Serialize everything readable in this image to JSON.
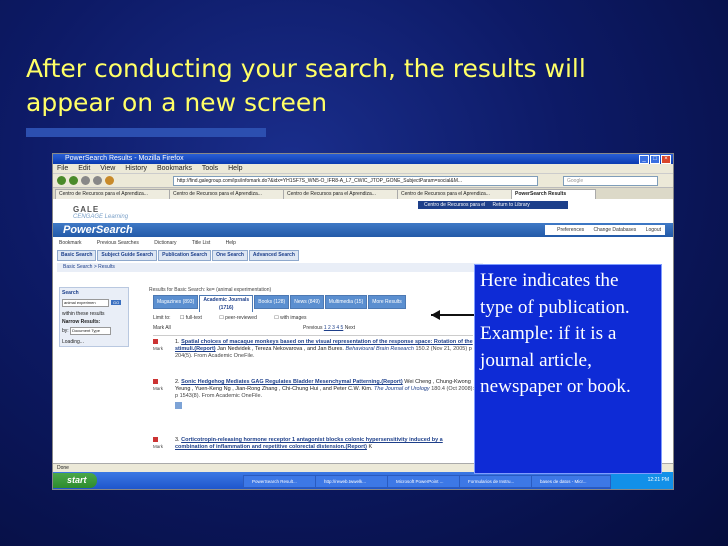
{
  "slide": {
    "title": "After conducting your search, the results will appear on a new screen",
    "callout_text": "Here indicates the type of publication. Example: if it is a journal article, newspaper or book.",
    "colors": {
      "title": "#ffff66",
      "background": "#0d1a66",
      "callout_bg": "#0e2bd6"
    }
  },
  "browser": {
    "window_title": "PowerSearch Results - Mozilla Firefox",
    "menu": [
      "File",
      "Edit",
      "View",
      "History",
      "Bookmarks",
      "Tools",
      "Help"
    ],
    "url": "http://find.galegroup.com/ips/infomark.do?&idx=YH1SF7S_WN5-O_IFR8-A_L7_CWIC_JTOP_GONE_SubjectParam=social&M...",
    "search_placeholder": "Google",
    "tabs": [
      "Centro de Recursos para el Aprendiza...",
      "Centro de Recursos para el Aprendiza...",
      "Centro de Recursos para el Aprendiza...",
      "Centro de Recursos para el Aprendiza...",
      "PowerSearch Results"
    ],
    "status": "Done"
  },
  "page": {
    "gale_name": "GALE",
    "gale_sub": "CENGAGE Learning",
    "top_links": [
      "Centro de Recursos para el",
      "Return to Library"
    ],
    "logo": "PowerSearch",
    "right_links": [
      "Preferences",
      "Change Databases",
      "Logout"
    ],
    "toolbar": [
      "Bookmark",
      "Previous Searches",
      "Dictionary",
      "Title List",
      "Help"
    ],
    "search_tabs": [
      "Basic Search",
      "Subject Guide Search",
      "Publication Search",
      "One Search",
      "Advanced Search"
    ],
    "breadcrumb": "Basic Search > Results",
    "left_panel": {
      "heading": "Search",
      "input_value": "animal experimen",
      "go": "GO",
      "within": "within these results",
      "narrow": "Narrow Results:",
      "by_label": "by:",
      "by_value": "Document Type",
      "loading": "Loading..."
    },
    "results_info": "Results for Basic Search: ke= (animal experimentation)",
    "pub_tabs": [
      "Magazines (893)",
      "Academic Journals (1716)",
      "Books (128)",
      "News (849)",
      "Multimedia (15)",
      "More Results"
    ],
    "limit_label": "Limit to:",
    "limit_options": [
      "full-text",
      "peer-reviewed",
      "with images"
    ],
    "mark_all": "Mark All",
    "pagination": {
      "prev": "Previous",
      "pages": "1 2 3 4 5",
      "next": "Next"
    },
    "mark_label": "Mark",
    "results": [
      {
        "num": "1.",
        "title": "Spatial choices of macaque monkeys based on the visual representation of the response space: Rotation of the stimuli.(Report)",
        "authors": "Jan Nedvidek , Tereza Nekovarova , and Jan Bures.",
        "source": "Behavioural Brain Research",
        "details": "150.2 (Nov 21, 2005) p 204(5). From Academic OneFile."
      },
      {
        "num": "2.",
        "title": "Sonic Hedgehog Mediates GAG Regulates Bladder Mesenchymal Patterning.(Report)",
        "authors": "Wei Cheng , Chung-Kwong Yeung , Yuen-Keng Ng , Jian-Rong Zhang , Chi-Chung Hui , and Peter C.W. Kim.",
        "source": "The Journal of Urology",
        "details": "180.4 (Oct 2008): p 1543(8). From Academic OneFile."
      },
      {
        "num": "3.",
        "title": "Corticotropin-releasing hormone receptor 1 antagonist blocks colonic hypersensitivity induced by a combination of inflammation and repetitive colorectal distension.(Report)",
        "authors": "K",
        "source": "",
        "details": ""
      }
    ]
  },
  "taskbar": {
    "start": "start",
    "tasks": [
      "PowerSearch Result...",
      "http://reweb.twwelk...",
      "Microsoft PowerPoint ...",
      "Formularios de Instru...",
      "bases de datos - Micr..."
    ],
    "clock": "12:21 PM"
  }
}
